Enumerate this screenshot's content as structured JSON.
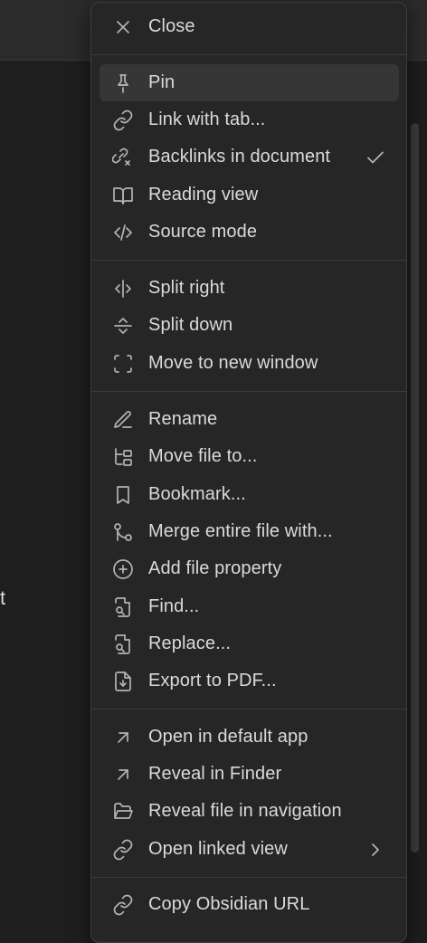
{
  "background": {
    "partial_text": "t"
  },
  "menu": {
    "close": "Close",
    "pin": "Pin",
    "link_with_tab": "Link with tab...",
    "backlinks": "Backlinks in document",
    "reading_view": "Reading view",
    "source_mode": "Source mode",
    "split_right": "Split right",
    "split_down": "Split down",
    "move_new_window": "Move to new window",
    "rename": "Rename",
    "move_file": "Move file to...",
    "bookmark": "Bookmark...",
    "merge": "Merge entire file with...",
    "add_property": "Add file property",
    "find": "Find...",
    "replace": "Replace...",
    "export_pdf": "Export to PDF...",
    "open_default": "Open in default app",
    "reveal_finder": "Reveal in Finder",
    "reveal_nav": "Reveal file in navigation",
    "open_linked": "Open linked view",
    "copy_url": "Copy Obsidian URL"
  },
  "state": {
    "hovered_item": "Pin",
    "backlinks_checked": true
  },
  "colors": {
    "menu_bg": "#262626",
    "hover_bg": "#363636",
    "text": "#dadada",
    "icon": "#b3b3b3",
    "separator": "#3b3b3b"
  },
  "icons": {
    "close": "x-icon",
    "pin": "pin-icon",
    "link_with_tab": "link-icon",
    "backlinks": "link-backlinks-icon",
    "reading_view": "book-open-icon",
    "source_mode": "code-icon",
    "split_right": "split-vertical-icon",
    "split_down": "split-horizontal-icon",
    "move_new_window": "scan-frame-icon",
    "rename": "pencil-icon",
    "move_file": "folder-tree-icon",
    "bookmark": "bookmark-icon",
    "merge": "git-merge-icon",
    "add_property": "plus-circle-icon",
    "find": "file-search-icon",
    "replace": "file-search-icon",
    "export_pdf": "file-download-icon",
    "open_default": "arrow-up-right-icon",
    "reveal_finder": "arrow-up-right-icon",
    "reveal_nav": "folder-open-icon",
    "open_linked": "link-icon",
    "copy_url": "link-icon"
  }
}
